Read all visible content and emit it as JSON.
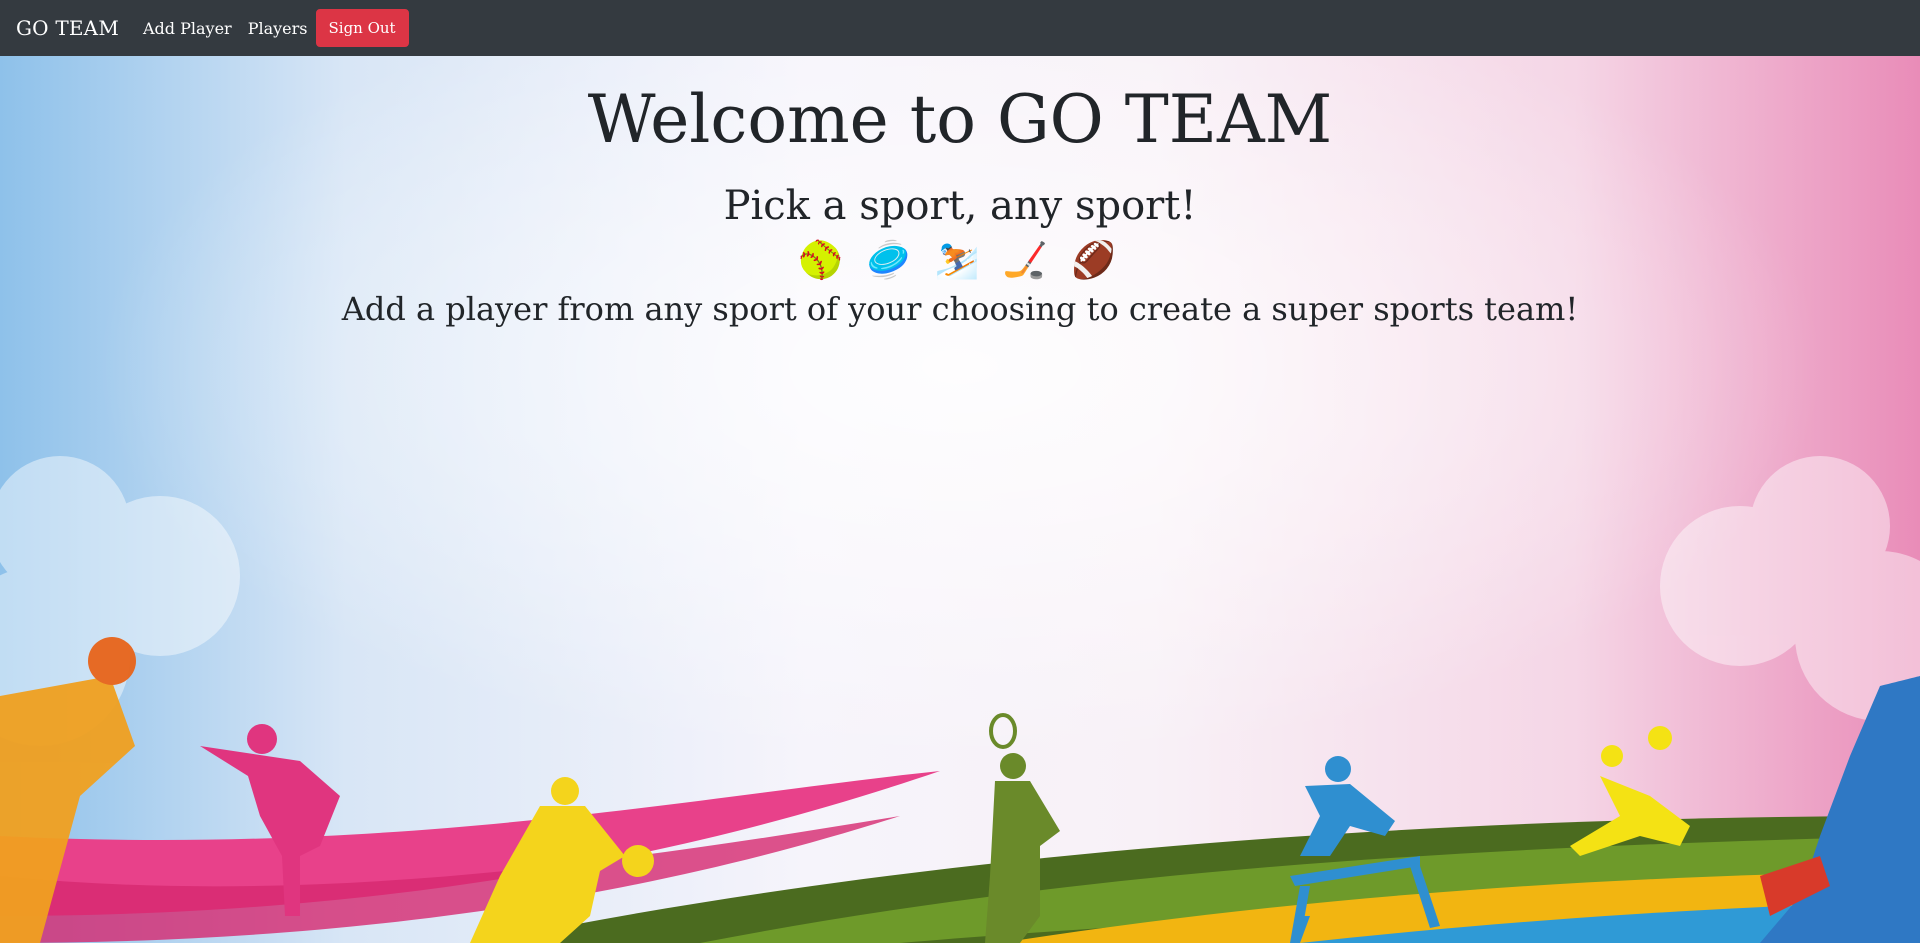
{
  "nav": {
    "brand": "GO TEAM",
    "add_player": "Add Player",
    "players": "Players",
    "sign_out": "Sign Out"
  },
  "hero": {
    "title": "Welcome to GO TEAM",
    "subtitle": "Pick a sport, any sport!",
    "emojis": "🥎 🥏 ⛷️ 🏒 🏈",
    "tagline": "Add a player from any sport of your choosing to create a super sports team!"
  },
  "colors": {
    "navbar": "#343a40",
    "danger": "#dc3545",
    "text": "#212529"
  }
}
